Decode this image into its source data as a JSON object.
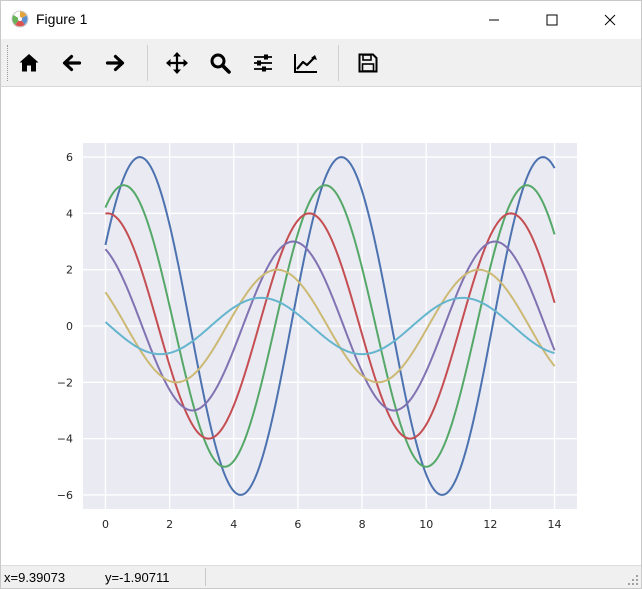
{
  "window": {
    "title": "Figure 1",
    "icons": {
      "app": "matplotlib-icon",
      "minimize": "minimize-icon",
      "maximize": "maximize-icon",
      "close": "close-icon"
    }
  },
  "toolbar": {
    "buttons": [
      {
        "name": "home-button",
        "icon": "home-icon"
      },
      {
        "name": "back-button",
        "icon": "arrow-left-icon"
      },
      {
        "name": "forward-button",
        "icon": "arrow-right-icon"
      },
      {
        "name": "pan-button",
        "icon": "move-icon"
      },
      {
        "name": "zoom-button",
        "icon": "search-icon"
      },
      {
        "name": "subplots-button",
        "icon": "sliders-icon"
      },
      {
        "name": "edit-axes-button",
        "icon": "line-chart-icon"
      },
      {
        "name": "save-button",
        "icon": "floppy-disk-icon"
      }
    ]
  },
  "status": {
    "x_text": "x=9.39073",
    "y_text": "y=-1.90711"
  },
  "chart_data": {
    "type": "line",
    "style": "seaborn-darkgrid",
    "background": "#eaeaf2",
    "grid": true,
    "xlim": [
      -0.7,
      14.7
    ],
    "ylim": [
      -6.5,
      6.5
    ],
    "xticks": [
      0,
      2,
      4,
      6,
      8,
      10,
      12,
      14
    ],
    "xtick_labels": [
      "0",
      "2",
      "4",
      "6",
      "8",
      "10",
      "12",
      "14"
    ],
    "yticks": [
      -6,
      -4,
      -2,
      0,
      2,
      4,
      6
    ],
    "ytick_labels": [
      "−6",
      "−4",
      "−2",
      "0",
      "2",
      "4",
      "6"
    ],
    "x_range": [
      0,
      14
    ],
    "formula": "y = amplitude * sin(x + 0.5 * (7 - amplitude))",
    "series": [
      {
        "amplitude": 6,
        "color": "#4c72b0"
      },
      {
        "amplitude": 5,
        "color": "#55a868"
      },
      {
        "amplitude": 4,
        "color": "#c44e52"
      },
      {
        "amplitude": 3,
        "color": "#8172b2"
      },
      {
        "amplitude": 2,
        "color": "#ccb974"
      },
      {
        "amplitude": 1,
        "color": "#64b5cd"
      }
    ]
  }
}
